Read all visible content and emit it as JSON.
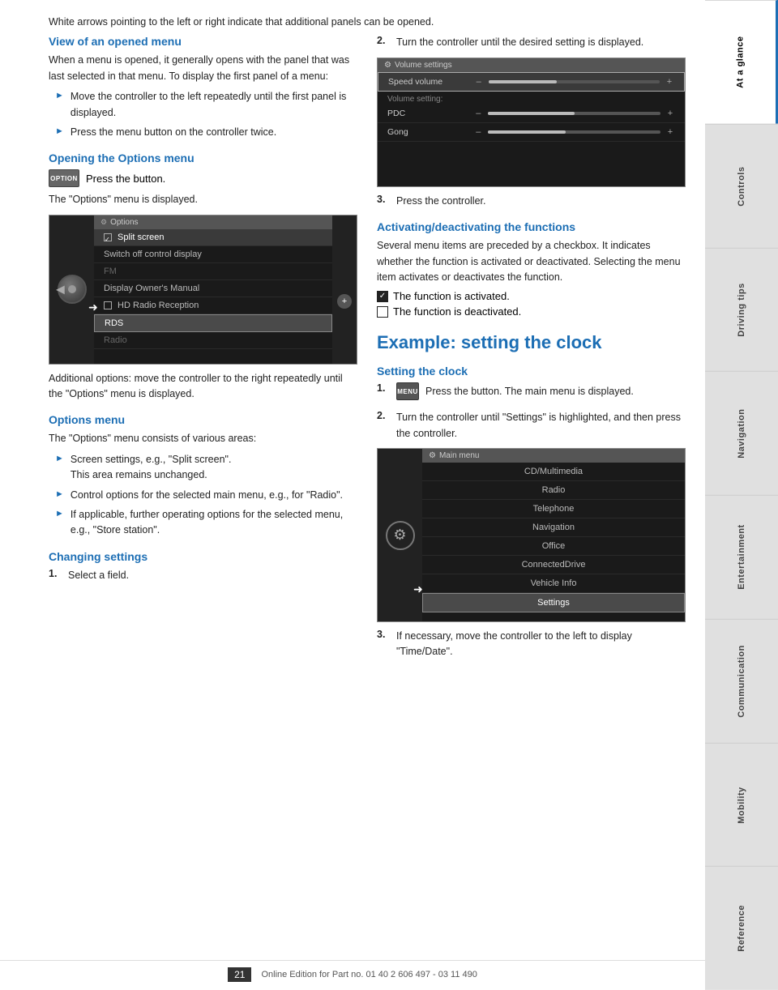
{
  "sidebar": {
    "tabs": [
      {
        "label": "At a glance",
        "active": true
      },
      {
        "label": "Controls",
        "active": false
      },
      {
        "label": "Driving tips",
        "active": false
      },
      {
        "label": "Navigation",
        "active": false
      },
      {
        "label": "Entertainment",
        "active": false
      },
      {
        "label": "Communication",
        "active": false
      },
      {
        "label": "Mobility",
        "active": false
      },
      {
        "label": "Reference",
        "active": false
      }
    ]
  },
  "page": {
    "number": "21",
    "footer_text": "Online Edition for Part no. 01 40 2 606 497 - 03 11 490"
  },
  "content": {
    "intro_text": "White arrows pointing to the left or right indicate that additional panels can be opened.",
    "section1": {
      "heading": "View of an opened menu",
      "body": "When a menu is opened, it generally opens with the panel that was last selected in that menu. To display the first panel of a menu:",
      "bullets": [
        "Move the controller to the left repeatedly until the first panel is displayed.",
        "Press the menu button on the controller twice."
      ]
    },
    "section2": {
      "heading": "Opening the Options menu",
      "option_btn_label": "OPTION",
      "inline_text": "Press the button.",
      "below_text": "The \"Options\" menu is displayed.",
      "additional_text": "Additional options: move the controller to the right repeatedly until the \"Options\" menu is displayed."
    },
    "section3": {
      "heading": "Options menu",
      "body": "The \"Options\" menu consists of various areas:",
      "bullets": [
        "Screen settings, e.g., \"Split screen\".\nThis area remains unchanged.",
        "Control options for the selected main menu, e.g., for \"Radio\".",
        "If applicable, further operating options for the selected menu, e.g., \"Store station\"."
      ]
    },
    "section4": {
      "heading": "Changing settings",
      "numbered": [
        {
          "num": "1.",
          "text": "Select a field."
        }
      ]
    },
    "section5": {
      "right_numbered_1": {
        "num": "2.",
        "text": "Turn the controller until the desired setting is displayed."
      },
      "right_numbered_2": {
        "num": "3.",
        "text": "Press the controller."
      }
    },
    "section6": {
      "heading": "Activating/deactivating the functions",
      "body": "Several menu items are preceded by a checkbox. It indicates whether the function is activated or deactivated. Selecting the menu item activates or deactivates the function.",
      "check_on": "The function is activated.",
      "check_off": "The function is deactivated."
    },
    "big_section": {
      "heading": "Example: setting the clock"
    },
    "section7": {
      "heading": "Setting the clock",
      "numbered": [
        {
          "num": "1.",
          "text": "Press the button. The main menu is displayed."
        },
        {
          "num": "2.",
          "text": "Turn the controller until \"Settings\" is highlighted, and then press the controller."
        },
        {
          "num": "3.",
          "text": "If necessary, move the controller to the left to display \"Time/Date\"."
        }
      ]
    },
    "options_menu_screenshot": {
      "title": "Options",
      "items": [
        {
          "label": "Split screen",
          "checked": true,
          "selected": false
        },
        {
          "label": "Switch off control display",
          "checked": false,
          "selected": false
        },
        {
          "label": "FM",
          "checked": false,
          "selected": false,
          "gray": true
        },
        {
          "label": "Display Owner's Manual",
          "checked": false,
          "selected": false
        },
        {
          "label": "HD Radio Reception",
          "checked": false,
          "selected": true
        },
        {
          "label": "RDS",
          "checked": false,
          "selected": true,
          "highlighted": true
        },
        {
          "label": "Radio",
          "checked": false,
          "selected": false,
          "gray": true
        }
      ]
    },
    "volume_screenshot": {
      "title": "Volume settings",
      "rows": [
        {
          "label": "Speed volume",
          "selected": true,
          "fill": 40
        },
        {
          "label": "Volume setting:",
          "selected": false,
          "is_header": true
        },
        {
          "label": "PDC",
          "selected": false,
          "fill": 50
        },
        {
          "label": "Gong",
          "selected": false,
          "fill": 45
        }
      ]
    },
    "mainmenu_screenshot": {
      "title": "Main menu",
      "items": [
        "CD/Multimedia",
        "Radio",
        "Telephone",
        "Navigation",
        "Office",
        "ConnectedDrive",
        "Vehicle Info",
        "Settings"
      ],
      "selected": "Settings"
    }
  }
}
